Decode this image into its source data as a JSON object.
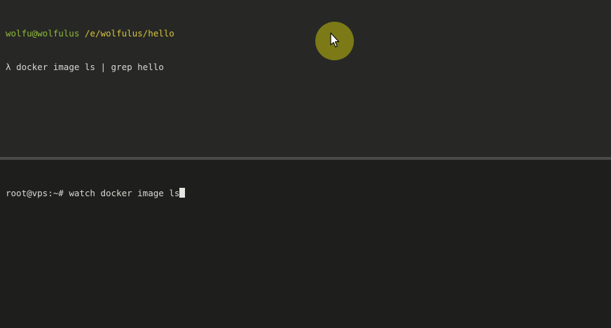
{
  "top_pane": {
    "prompt_user": "wolfu@wolfulus",
    "prompt_path": "/e/wolfulus/hello",
    "prompt_symbol": "λ",
    "command": "docker image ls | grep hello"
  },
  "bottom_pane": {
    "prompt": "root@vps:~#",
    "command": "watch docker image ls"
  },
  "colors": {
    "user": "#8fb83a",
    "path": "#d7c33c",
    "text": "#d8d8d2",
    "highlight": "#7b7a16"
  },
  "icons": {
    "pointer": "mouse-pointer-icon"
  }
}
